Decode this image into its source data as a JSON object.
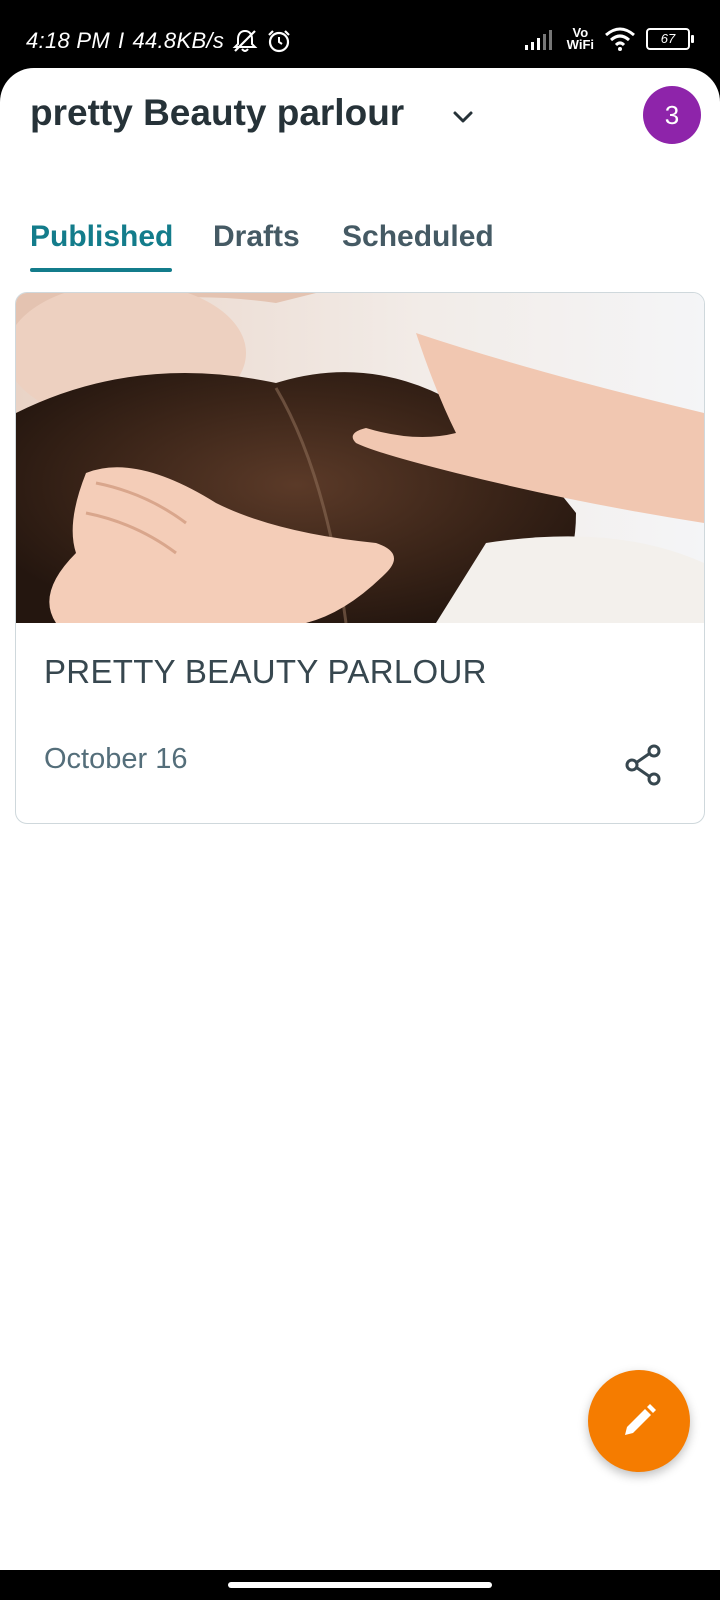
{
  "status_bar": {
    "time": "4:18 PM",
    "speed": "44.8KB/s",
    "vowifi_top": "Vo",
    "vowifi_bottom": "WiFi",
    "battery": "67"
  },
  "header": {
    "business_name": "pretty Beauty parlour",
    "avatar_badge": "3"
  },
  "tabs": [
    {
      "label": "Published",
      "active": true
    },
    {
      "label": "Drafts",
      "active": false
    },
    {
      "label": "Scheduled",
      "active": false
    }
  ],
  "posts": [
    {
      "title": "PRETTY BEAUTY PARLOUR",
      "date": "October 16"
    }
  ],
  "colors": {
    "accent": "#137c8b",
    "avatar": "#8e24aa",
    "fab": "#f57c00",
    "title_text": "#263238"
  },
  "icons": {
    "dropdown": "chevron-down-icon",
    "share": "share-icon",
    "fab": "pencil-icon"
  }
}
